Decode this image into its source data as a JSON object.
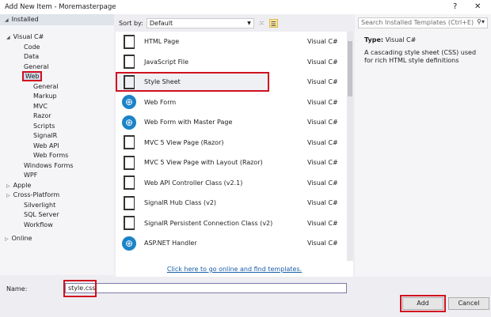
{
  "window": {
    "title": "Add New Item - Moremasterpage",
    "help": "?",
    "close": "✕"
  },
  "tree": {
    "installed": "Installed",
    "online": "Online",
    "items": [
      "Visual C#",
      "Code",
      "Data",
      "General",
      "Web",
      "General",
      "Markup",
      "MVC",
      "Razor",
      "Scripts",
      "SignalR",
      "Web API",
      "Web Forms",
      "Windows Forms",
      "WPF",
      "Apple",
      "Cross-Platform",
      "Silverlight",
      "SQL Server",
      "Workflow"
    ]
  },
  "toolbar": {
    "sort_label": "Sort by:",
    "sort_value": "Default"
  },
  "templates": [
    {
      "name": "HTML Page",
      "lang": "Visual C#",
      "icon": "html-page"
    },
    {
      "name": "JavaScript File",
      "lang": "Visual C#",
      "icon": "js-file"
    },
    {
      "name": "Style Sheet",
      "lang": "Visual C#",
      "icon": "css-file"
    },
    {
      "name": "Web Form",
      "lang": "Visual C#",
      "icon": "globe"
    },
    {
      "name": "Web Form with Master Page",
      "lang": "Visual C#",
      "icon": "globe"
    },
    {
      "name": "MVC 5 View Page (Razor)",
      "lang": "Visual C#",
      "icon": "razor"
    },
    {
      "name": "MVC 5 View Page with Layout (Razor)",
      "lang": "Visual C#",
      "icon": "razor"
    },
    {
      "name": "Web API Controller Class (v2.1)",
      "lang": "Visual C#",
      "icon": "class"
    },
    {
      "name": "SignalR Hub Class (v2)",
      "lang": "Visual C#",
      "icon": "class"
    },
    {
      "name": "SignalR Persistent Connection Class (v2)",
      "lang": "Visual C#",
      "icon": "class"
    },
    {
      "name": "ASP.NET Handler",
      "lang": "Visual C#",
      "icon": "globe-doc"
    }
  ],
  "online_link": "Click here to go online and find templates.",
  "search": {
    "placeholder": "Search Installed Templates (Ctrl+E)"
  },
  "details": {
    "type_label": "Type:",
    "type_value": "Visual C#",
    "description": "A cascading style sheet (CSS) used for rich HTML style definitions"
  },
  "name_field": {
    "label": "Name:",
    "value": "style.css"
  },
  "buttons": {
    "add": "Add",
    "cancel": "Cancel"
  }
}
